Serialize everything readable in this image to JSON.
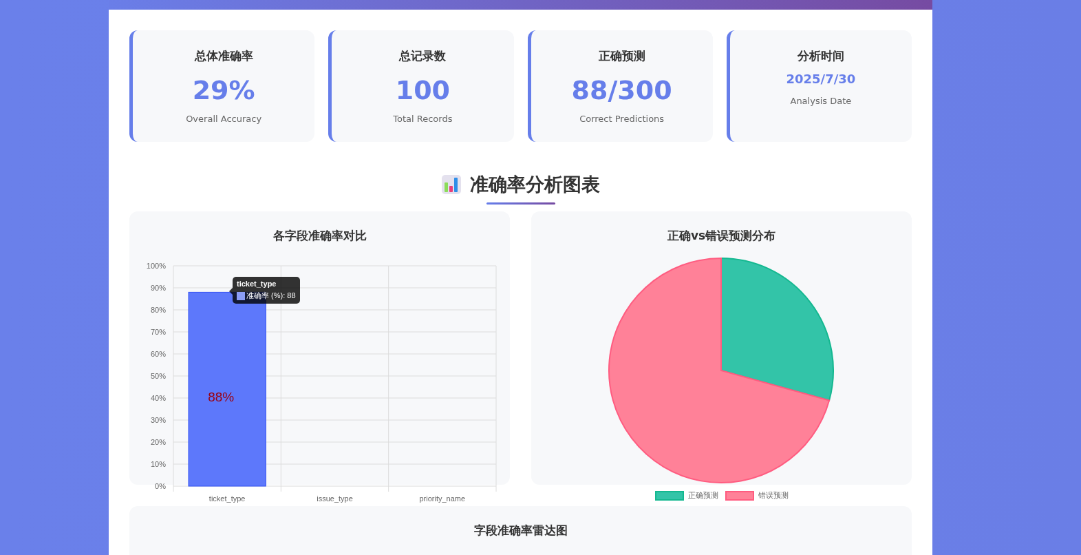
{
  "stats": [
    {
      "title": "总体准确率",
      "value": "29%",
      "subtitle": "Overall Accuracy",
      "kind": "big"
    },
    {
      "title": "总记录数",
      "value": "100",
      "subtitle": "Total Records",
      "kind": "big"
    },
    {
      "title": "正确预测",
      "value": "88/300",
      "subtitle": "Correct Predictions",
      "kind": "big"
    },
    {
      "title": "分析时间",
      "value": "2025/7/30",
      "subtitle": "Analysis Date",
      "kind": "small"
    }
  ],
  "section_title": "准确率分析图表",
  "bar_panel": {
    "title": "各字段准确率对比",
    "chart_data": {
      "type": "bar",
      "categories": [
        "ticket_type",
        "issue_type",
        "priority_name"
      ],
      "series": [
        {
          "color": "#5b76fb",
          "values": [
            88,
            0,
            0
          ]
        }
      ],
      "grid": true,
      "ylim": [
        0,
        100
      ],
      "yticks": [
        {
          "value": 0,
          "label": "0%"
        },
        {
          "value": 10,
          "label": "10%"
        },
        {
          "value": 20,
          "label": "20%"
        },
        {
          "value": 30,
          "label": "30%"
        },
        {
          "value": 40,
          "label": "40%"
        },
        {
          "value": 50,
          "label": "50%"
        },
        {
          "value": 60,
          "label": "60%"
        },
        {
          "value": 70,
          "label": "70%"
        },
        {
          "value": 80,
          "label": "80%"
        },
        {
          "value": 90,
          "label": "90%"
        },
        {
          "value": 100,
          "label": "100%"
        }
      ],
      "value_labels": [
        "88%",
        null,
        null
      ]
    },
    "tooltip": {
      "title": "ticket_type",
      "label": "准确率 (%): 88"
    }
  },
  "pie_panel": {
    "title": "正确vs错误预测分布",
    "chart_data": {
      "type": "pie",
      "categories": [
        "正确预测",
        "错误预测"
      ],
      "series": [
        {
          "values": [
            29.3,
            70.7
          ]
        }
      ],
      "colors": [
        "#33c4a8",
        "#ff8198"
      ]
    }
  },
  "radar_panel": {
    "title": "字段准确率雷达图"
  }
}
